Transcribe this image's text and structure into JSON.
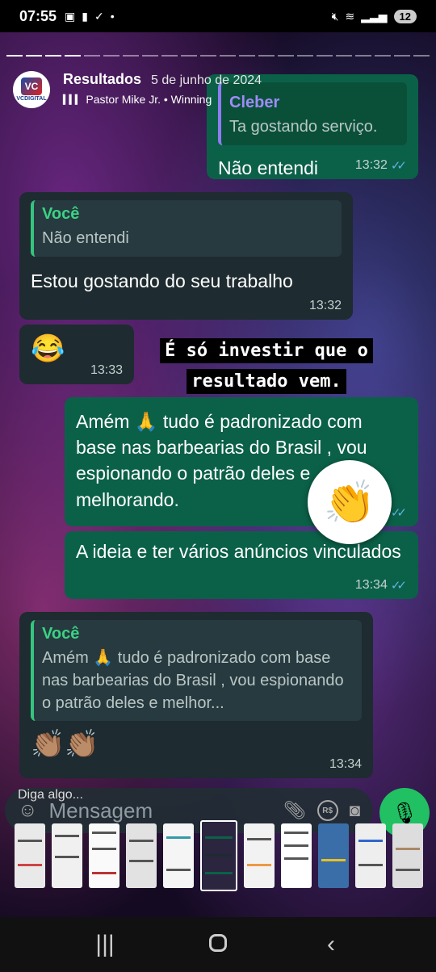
{
  "status_bar": {
    "time": "07:55",
    "battery": "12"
  },
  "story": {
    "profile": {
      "name": "Resultados",
      "date": "5 de junho de 2024",
      "music": "Pastor Mike Jr. • Winning",
      "avatar_label": "VCDIGITAL"
    },
    "caption": "É só investir que o resultado vem.",
    "reaction_sticker": "👏"
  },
  "messages": [
    {
      "quote_author": "Cleber",
      "quote_text": "Ta gostando serviço.",
      "text": "Não entendi",
      "time": "13:32"
    },
    {
      "quote_author": "Você",
      "quote_text": "Não entendi",
      "text": "Estou gostando do seu trabalho",
      "time": "13:32"
    },
    {
      "text": "😂",
      "time": "13:33"
    },
    {
      "text": "Amém 🙏 tudo é padronizado com base nas barbearias do Brasil , vou espionando o patrão deles e melhorando.",
      "text_visible": "Amém 🙏 tudo é padronizado com base nas barbearias do Brasil , vou espionando o [sticker] deles e melhorando."
    },
    {
      "text": "A ideia e ter vários anúncios vinculados",
      "time": "13:34"
    },
    {
      "quote_author": "Você",
      "quote_text": "Amém 🙏 tudo é padronizado com base nas barbearias do Brasil , vou espionando o patrão deles e melhor...",
      "text": "👏🏽👏🏽",
      "time": "13:34"
    }
  ],
  "reply": {
    "label": "Diga algo...",
    "placeholder": "Mensagem"
  },
  "colors": {
    "outgoing_bubble": "#0b6148",
    "incoming_bubble": "#1e2b30",
    "mic_button": "#21c063"
  }
}
